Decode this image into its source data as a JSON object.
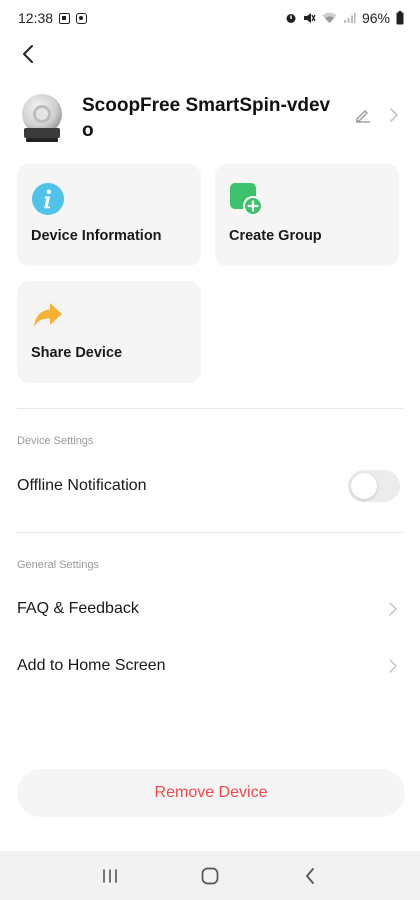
{
  "status_bar": {
    "time": "12:38",
    "battery": "96%",
    "left_icons": [
      "gallery-icon",
      "screen-record-icon"
    ],
    "right_icons": [
      "alarm-icon",
      "mute-icon",
      "wifi-icon",
      "signal-icon",
      "battery-icon"
    ]
  },
  "header": {
    "back_icon": "back-arrow-icon",
    "device_name": "ScoopFree SmartSpin-vdevo",
    "edit_icon": "pencil-icon",
    "chevron_icon": "chevron-right-icon"
  },
  "cards": [
    {
      "label": "Device Information",
      "icon": "info-icon",
      "color": "#4fc3e8"
    },
    {
      "label": "Create Group",
      "icon": "add-group-icon",
      "color": "#3cc26b"
    },
    {
      "label": "Share Device",
      "icon": "share-arrow-icon",
      "color": "#f6b234"
    }
  ],
  "device_settings": {
    "title": "Device Settings",
    "offline_notification": {
      "label": "Offline Notification",
      "enabled": false
    }
  },
  "general_settings": {
    "title": "General Settings",
    "items": [
      {
        "label": "FAQ & Feedback"
      },
      {
        "label": "Add to Home Screen"
      }
    ]
  },
  "remove_button": {
    "label": "Remove Device",
    "color": "#f04a4a"
  },
  "nav_bar": {
    "icons": [
      "recent-apps-icon",
      "home-icon",
      "nav-back-icon"
    ]
  }
}
